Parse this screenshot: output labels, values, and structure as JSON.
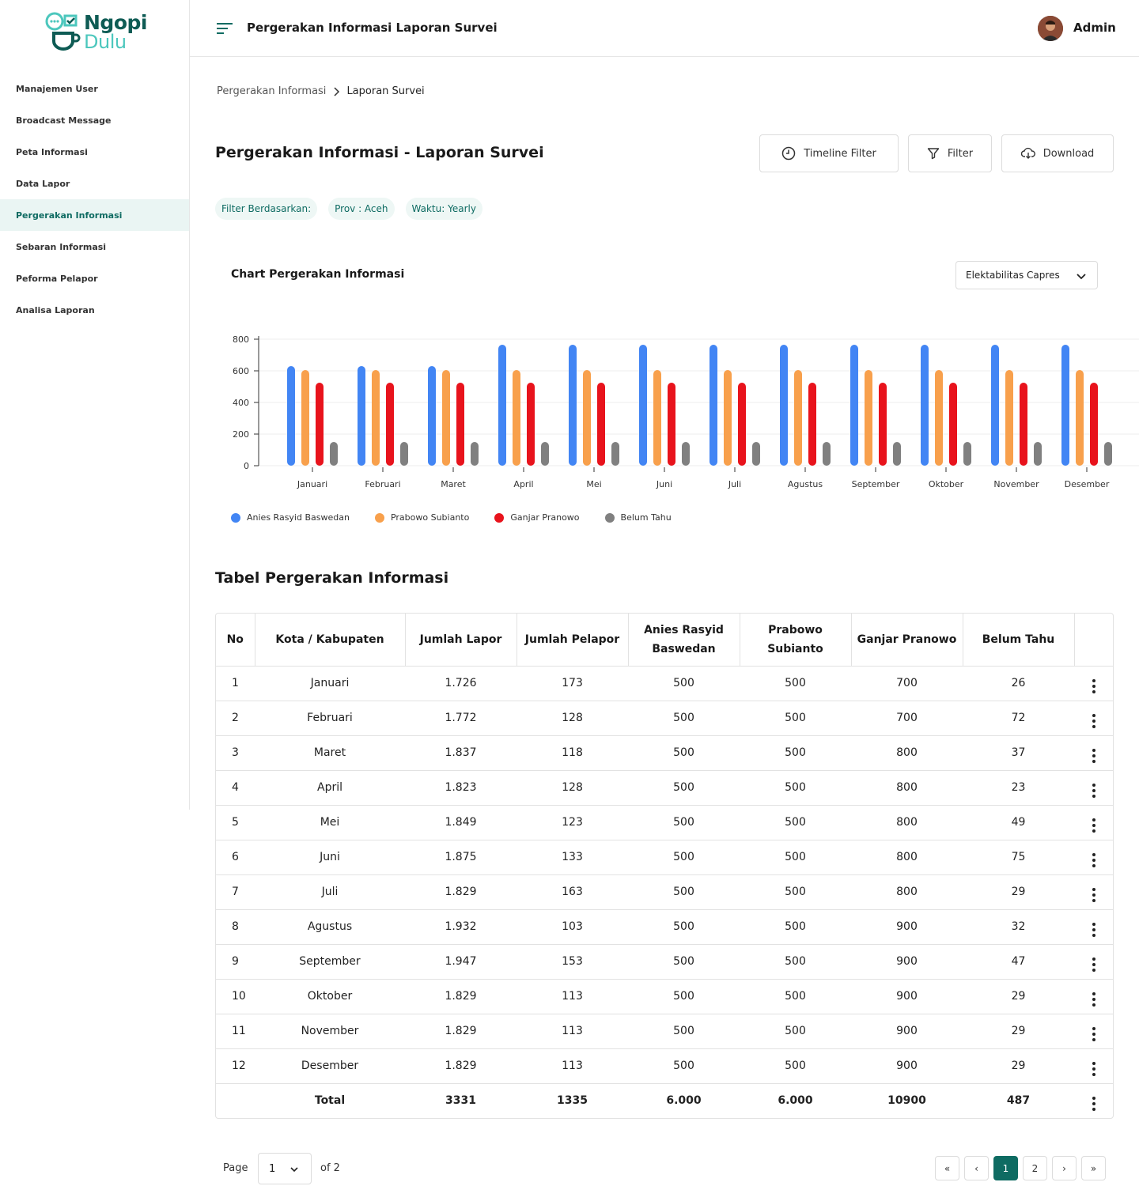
{
  "brand": {
    "line1": "Ngopi",
    "line2": "Dulu"
  },
  "sidebar": {
    "items": [
      {
        "label": "Manajemen User"
      },
      {
        "label": "Broadcast Message"
      },
      {
        "label": "Peta Informasi"
      },
      {
        "label": "Data Lapor"
      },
      {
        "label": "Pergerakan Informasi"
      },
      {
        "label": "Sebaran Informasi"
      },
      {
        "label": "Peforma Pelapor"
      },
      {
        "label": "Analisa Laporan"
      }
    ],
    "active_index": 4
  },
  "header": {
    "title": "Pergerakan Informasi Laporan Survei",
    "user": "Admin"
  },
  "breadcrumb": {
    "parent": "Pergerakan Informasi",
    "current": "Laporan Survei"
  },
  "page": {
    "title": "Pergerakan Informasi - Laporan Survei",
    "buttons": {
      "timeline": "Timeline Filter",
      "filter": "Filter",
      "download": "Download"
    },
    "chips": {
      "label": "Filter Berdasarkan:",
      "prov": "Prov : Aceh",
      "waktu": "Waktu: Yearly"
    }
  },
  "chart": {
    "title": "Chart Pergerakan Informasi",
    "select_value": "Elektabilitas Capres"
  },
  "chart_data": {
    "type": "bar",
    "categories": [
      "Januari",
      "Februari",
      "Maret",
      "April",
      "Mei",
      "Juni",
      "Juli",
      "Agustus",
      "September",
      "Oktober",
      "November",
      "Desember"
    ],
    "series": [
      {
        "name": "Anies Rasyid Baswedan",
        "color": "#4285f4",
        "values": [
          630,
          630,
          630,
          765,
          765,
          765,
          765,
          765,
          765,
          765,
          765,
          765
        ]
      },
      {
        "name": "Prabowo Subianto",
        "color": "#f8a04c",
        "values": [
          605,
          605,
          605,
          605,
          605,
          605,
          605,
          605,
          605,
          605,
          605,
          605
        ]
      },
      {
        "name": "Ganjar Pranowo",
        "color": "#e8131c",
        "values": [
          525,
          525,
          525,
          525,
          525,
          525,
          525,
          525,
          525,
          525,
          525,
          525
        ]
      },
      {
        "name": "Belum Tahu",
        "color": "#808080",
        "values": [
          150,
          150,
          150,
          150,
          150,
          150,
          150,
          150,
          150,
          150,
          150,
          150
        ]
      }
    ],
    "yticks": [
      "0",
      "200",
      "400",
      "600",
      "800"
    ],
    "ylim": [
      0,
      800
    ],
    "grid": true,
    "legend_position": "bottom-left"
  },
  "table": {
    "title": "Tabel Pergerakan Informasi",
    "headers": [
      "No",
      "Kota / Kabupaten",
      "Jumlah Lapor",
      "Jumlah Pelapor",
      "Anies Rasyid Baswedan",
      "Prabowo Subianto",
      "Ganjar Pranowo",
      "Belum Tahu"
    ],
    "rows": [
      [
        "1",
        "Januari",
        "1.726",
        "173",
        "500",
        "500",
        "700",
        "26"
      ],
      [
        "2",
        "Februari",
        "1.772",
        "128",
        "500",
        "500",
        "700",
        "72"
      ],
      [
        "3",
        "Maret",
        "1.837",
        "118",
        "500",
        "500",
        "800",
        "37"
      ],
      [
        "4",
        "April",
        "1.823",
        "128",
        "500",
        "500",
        "800",
        "23"
      ],
      [
        "5",
        "Mei",
        "1.849",
        "123",
        "500",
        "500",
        "800",
        "49"
      ],
      [
        "6",
        "Juni",
        "1.875",
        "133",
        "500",
        "500",
        "800",
        "75"
      ],
      [
        "7",
        "Juli",
        "1.829",
        "163",
        "500",
        "500",
        "800",
        "29"
      ],
      [
        "8",
        "Agustus",
        "1.932",
        "103",
        "500",
        "500",
        "900",
        "32"
      ],
      [
        "9",
        "September",
        "1.947",
        "153",
        "500",
        "500",
        "900",
        "47"
      ],
      [
        "10",
        "Oktober",
        "1.829",
        "113",
        "500",
        "500",
        "900",
        "29"
      ],
      [
        "11",
        "November",
        "1.829",
        "113",
        "500",
        "500",
        "900",
        "29"
      ],
      [
        "12",
        "Desember",
        "1.829",
        "113",
        "500",
        "500",
        "900",
        "29"
      ]
    ],
    "total": [
      "",
      "Total",
      "3331",
      "1335",
      "6.000",
      "6.000",
      "10900",
      "487"
    ]
  },
  "pagination": {
    "page_label": "Page",
    "current": "1",
    "of_label": "of 2",
    "pages": [
      "1",
      "2"
    ],
    "first": "«",
    "prev": "‹",
    "next": "›",
    "last": "»"
  },
  "colors": {
    "accent": "#0e6b62",
    "accent_light": "#eaf5f3"
  }
}
